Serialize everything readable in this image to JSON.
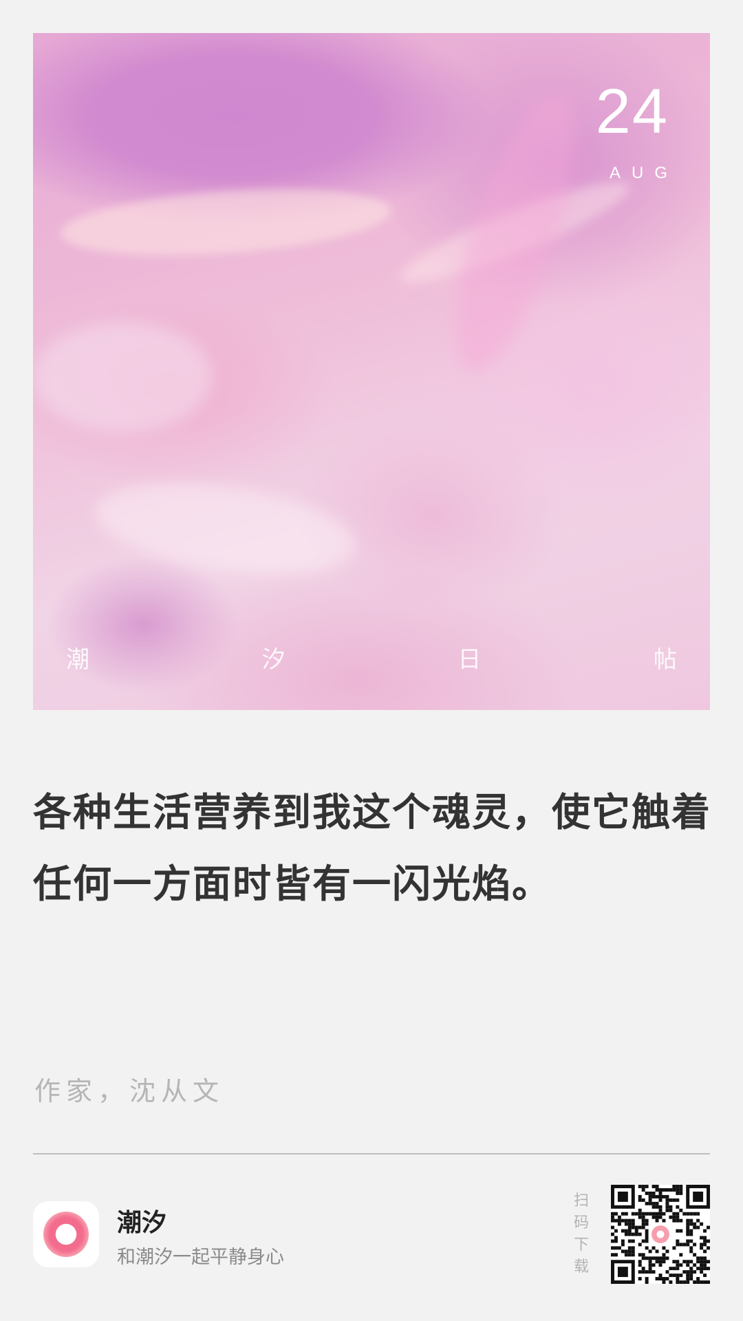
{
  "header_card": {
    "date_day": "24",
    "date_month": "AUG",
    "brand_chars": [
      "潮",
      "汐",
      "日",
      "帖"
    ]
  },
  "quote": {
    "text": "各种生活营养到我这个魂灵，使它触着任何一方面时皆有一闪光焰。",
    "author": "作家，沈从文"
  },
  "footer": {
    "app_name": "潮汐",
    "app_slogan": "和潮汐一起平静身心",
    "scan_label": [
      "扫",
      "码",
      "下",
      "载"
    ]
  },
  "colors": {
    "background": "#f2f2f2",
    "quote_text": "#333333",
    "author_text": "#b5b5b5",
    "app_icon_accent": "#f36c8d",
    "card_tone": "#e6a8d4"
  },
  "icons": {
    "app_icon": "tide-app-icon",
    "qr_code": "qr-code-icon"
  }
}
